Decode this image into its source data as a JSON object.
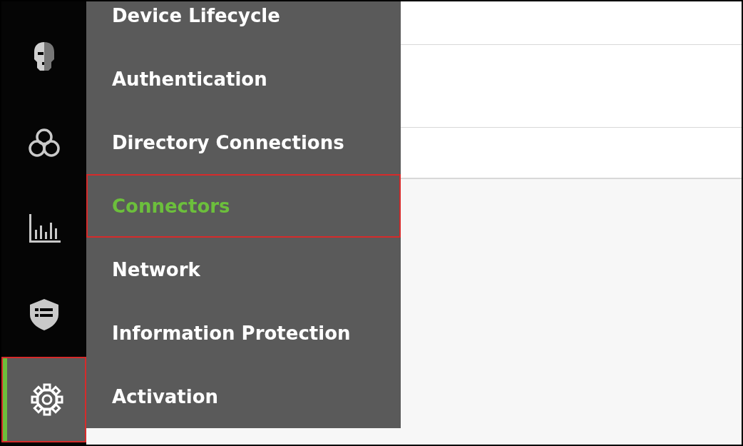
{
  "rail": [
    {
      "kind": "mask",
      "selected": false,
      "highlighted": false
    },
    {
      "kind": "circles",
      "selected": false,
      "highlighted": false
    },
    {
      "kind": "chart",
      "selected": false,
      "highlighted": false
    },
    {
      "kind": "shield",
      "selected": false,
      "highlighted": false
    },
    {
      "kind": "settings",
      "selected": true,
      "highlighted": true
    }
  ],
  "menu": [
    {
      "label": "Device Lifecycle",
      "selected": false,
      "highlighted": false
    },
    {
      "label": "Authentication",
      "selected": false,
      "highlighted": false
    },
    {
      "label": "Directory Connections",
      "selected": false,
      "highlighted": false
    },
    {
      "label": "Connectors",
      "selected": true,
      "highlighted": true
    },
    {
      "label": "Network",
      "selected": false,
      "highlighted": false
    },
    {
      "label": "Information Protection",
      "selected": false,
      "highlighted": false
    },
    {
      "label": "Activation",
      "selected": false,
      "highlighted": false
    }
  ]
}
